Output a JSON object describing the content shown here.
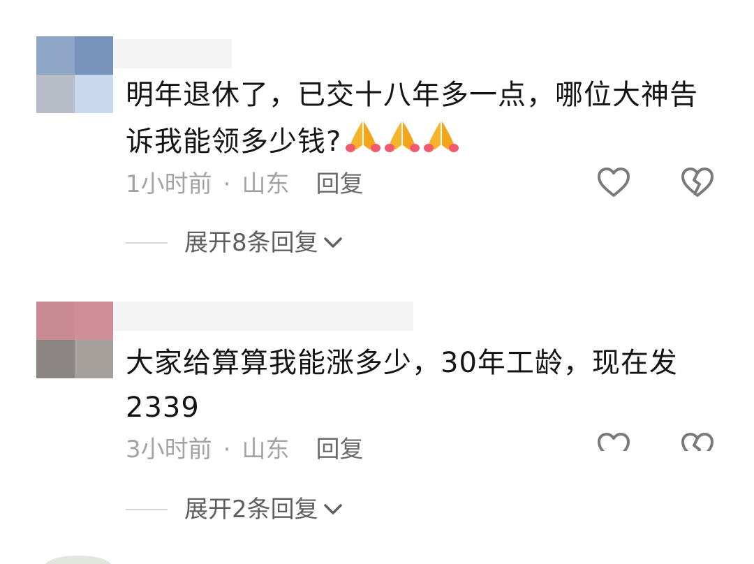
{
  "comments": [
    {
      "text": "明年退休了，已交十八年多一点，哪位大神告诉我能领多少钱?",
      "emoji": [
        "folded-hands",
        "folded-hands",
        "folded-hands"
      ],
      "time": "1小时前",
      "separator": "·",
      "location": "山东",
      "reply_label": "回复",
      "expand_label": "展开8条回复"
    },
    {
      "text": "大家给算算我能涨多少，30年工龄，现在发2339",
      "time": "3小时前",
      "separator": "·",
      "location": "山东",
      "reply_label": "回复",
      "expand_label": "展开2条回复"
    }
  ],
  "icons": {
    "like": "heart-outline-icon",
    "dislike": "broken-heart-outline-icon",
    "expand": "chevron-down-icon",
    "emoji": "folded-hands-emoji"
  },
  "colors": {
    "text": "#141414",
    "meta": "#a3a3a3",
    "reply": "#6a6a6a",
    "icon": "#7a7a7a",
    "expand": "#5f5f5f",
    "emoji": "#f6b42a"
  }
}
